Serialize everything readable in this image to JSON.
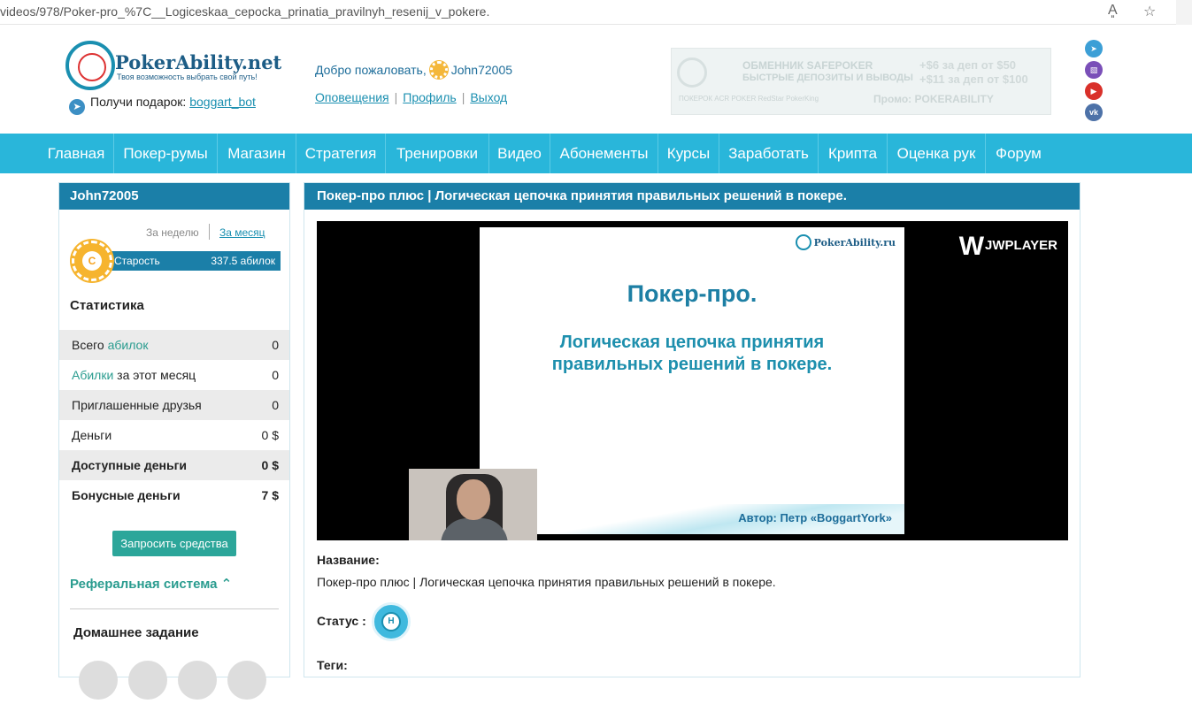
{
  "browser": {
    "url": "videos/978/Poker-pro_%7C__Logiceskaa_cepocka_prinatia_pravilnyh_resenij_v_pokere.",
    "read_aloud_icon": "read-aloud-icon",
    "favorite_icon": "star-icon"
  },
  "header": {
    "logo_name": "PokerAbility.net",
    "logo_tagline": "Твоя возможность выбрать свой путь!",
    "gift_label": "Получи подарок:",
    "gift_link": "boggart_bot",
    "welcome_label": "Добро пожаловать,",
    "username": "John72005",
    "links": [
      "Оповещения",
      "Профиль",
      "Выход"
    ]
  },
  "banner": {
    "line1": "ОБМЕННИК SAFEPOKER",
    "line2": "БЫСТРЫЕ ДЕПОЗИТЫ И ВЫВОДЫ",
    "offer1": "+$6 за деп от $50",
    "offer2": "+$11 за деп от $100",
    "promo": "Промо: POKERABILITY",
    "brands": "ПОКЕРОК  ACR POKER  RedStar  PokerKing"
  },
  "socials": [
    "telegram-icon",
    "twitch-icon",
    "youtube-icon",
    "vk-icon"
  ],
  "nav": [
    "Главная",
    "Покер-румы",
    "Магазин",
    "Стратегия",
    "Тренировки",
    "Видео",
    "Абонементы",
    "Курсы",
    "Заработать",
    "Крипта",
    "Оценка рук",
    "Форум"
  ],
  "sidebar": {
    "title": "John72005",
    "period_week": "За неделю",
    "period_month": "За месяц",
    "rank_letter": "С",
    "rank_name": "Старость",
    "rank_value": "337.5 абилок",
    "stats_title": "Статистика",
    "stats": [
      {
        "label_pre": "Всего ",
        "label_hl": "абилок",
        "label_post": "",
        "value": "0"
      },
      {
        "label_pre": "",
        "label_hl": "Абилки",
        "label_post": " за этот месяц",
        "value": "0"
      },
      {
        "label_pre": "Приглашенные друзья",
        "label_hl": "",
        "label_post": "",
        "value": "0"
      },
      {
        "label_pre": "Деньги",
        "label_hl": "",
        "label_post": "",
        "value": "0 $"
      },
      {
        "label_pre": "Доступные деньги",
        "label_hl": "",
        "label_post": "",
        "value": "0 $"
      },
      {
        "label_pre": "Бонусные деньги",
        "label_hl": "",
        "label_post": "",
        "value": "7 $"
      }
    ],
    "request_button": "Запросить средства",
    "referral": "Реферальная система",
    "homework": "Домашнее задание"
  },
  "main": {
    "title": "Покер-про плюс | Логическая цепочка принятия правильных решений в покере.",
    "slide": {
      "logo": "PokerAbility.ru",
      "title": "Покер-про.",
      "subtitle_line1": "Логическая цепочка принятия",
      "subtitle_line2": "правильных решений в покере.",
      "author": "Автор: Петр «BoggartYork»"
    },
    "player_brand": "JWPLAYER",
    "name_label": "Название:",
    "name_value": "Покер-про плюс |  Логическая цепочка принятия правильных решений в покере.",
    "status_label": "Статус :",
    "status_badge": "Н",
    "tags_label": "Теги:"
  }
}
